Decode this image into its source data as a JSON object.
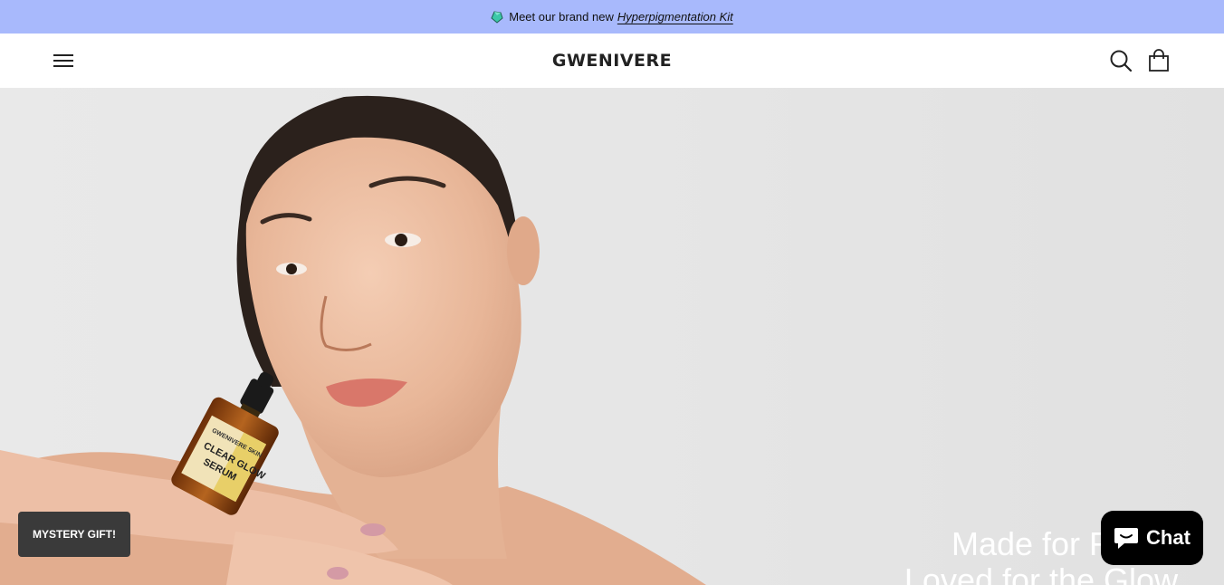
{
  "announcement": {
    "message": "Meet our brand new",
    "link_text": "Hyperpigmentation Kit",
    "icon": "gem-icon"
  },
  "header": {
    "logo": "GWENIVERE",
    "menu_icon": "hamburger-menu-icon",
    "search_icon": "search-icon",
    "cart_icon": "shopping-bag-icon"
  },
  "hero": {
    "bottle_brand": "GWENIVERE SKIN",
    "bottle_label_line1": "CLEAR GLOW",
    "bottle_label_line2": "SERUM",
    "headline_line1": "Made for Re",
    "headline_line2": "Loved for the Glow"
  },
  "widgets": {
    "mystery_gift": "MYSTERY GIFT!",
    "chat": "Chat"
  },
  "colors": {
    "announcement_bg": "#a8b9fc",
    "header_bg": "#ffffff",
    "chat_bg": "#000000",
    "mystery_bg": "#3a3a3a"
  }
}
